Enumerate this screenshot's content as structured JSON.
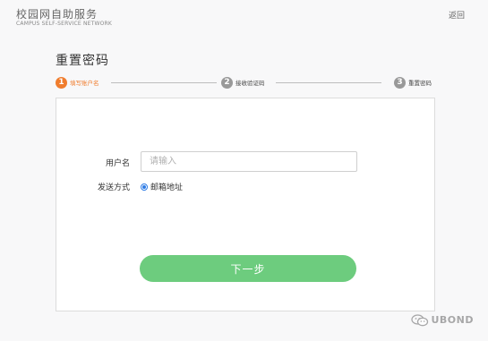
{
  "header": {
    "title": "校园网自助服务",
    "subtitle": "CAMPUS  SELF-SERVICE NETWORK",
    "back_label": "返回"
  },
  "page": {
    "title": "重置密码"
  },
  "steps": [
    {
      "number": "1",
      "label": "填写账户名",
      "active": true
    },
    {
      "number": "2",
      "label": "接收验证码",
      "active": false
    },
    {
      "number": "3",
      "label": "重置密码",
      "active": false
    }
  ],
  "form": {
    "username_label": "用户名",
    "username_value": "",
    "username_placeholder": "请输入",
    "send_method_label": "发送方式",
    "send_method_option": "邮箱地址",
    "send_method_selected": true,
    "next_label": "下一步"
  },
  "watermark": {
    "text": "UBOND"
  },
  "colors": {
    "accent_active": "#f07d2e",
    "button": "#6dcc7e",
    "radio": "#2d7be5"
  }
}
